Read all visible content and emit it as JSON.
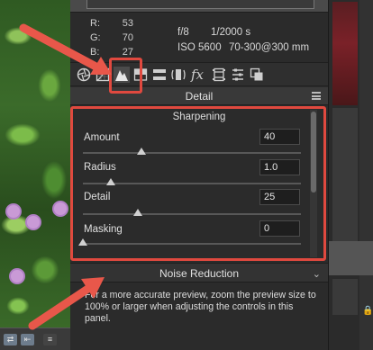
{
  "readout": {
    "r_label": "R:",
    "r_value": "53",
    "g_label": "G:",
    "g_value": "70",
    "b_label": "B:",
    "b_value": "27",
    "aperture": "f/8",
    "shutter": "1/2000 s",
    "iso": "ISO 5600",
    "lens": "70-300@300 mm"
  },
  "toolbar": {
    "tools": [
      "aperture-icon",
      "tone-curve-icon",
      "detail-icon",
      "hsl-icon",
      "split-toning-icon",
      "lens-corrections-icon",
      "effects-icon",
      "camera-calibration-icon",
      "presets-icon",
      "snapshots-icon"
    ],
    "active": "detail-icon"
  },
  "panel": {
    "title": "Detail"
  },
  "sharpening": {
    "title": "Sharpening",
    "controls": [
      {
        "label": "Amount",
        "value": "40",
        "fraction": 0.27
      },
      {
        "label": "Radius",
        "value": "1.0",
        "fraction": 0.13
      },
      {
        "label": "Detail",
        "value": "25",
        "fraction": 0.25
      },
      {
        "label": "Masking",
        "value": "0",
        "fraction": 0.0
      }
    ]
  },
  "noise_reduction": {
    "title": "Noise Reduction",
    "notice": "For a more accurate preview, zoom the preview size to 100% or larger when adjusting the controls in this panel."
  },
  "colors": {
    "highlight": "#e0493f",
    "panel_bg": "#2b2b2b"
  }
}
